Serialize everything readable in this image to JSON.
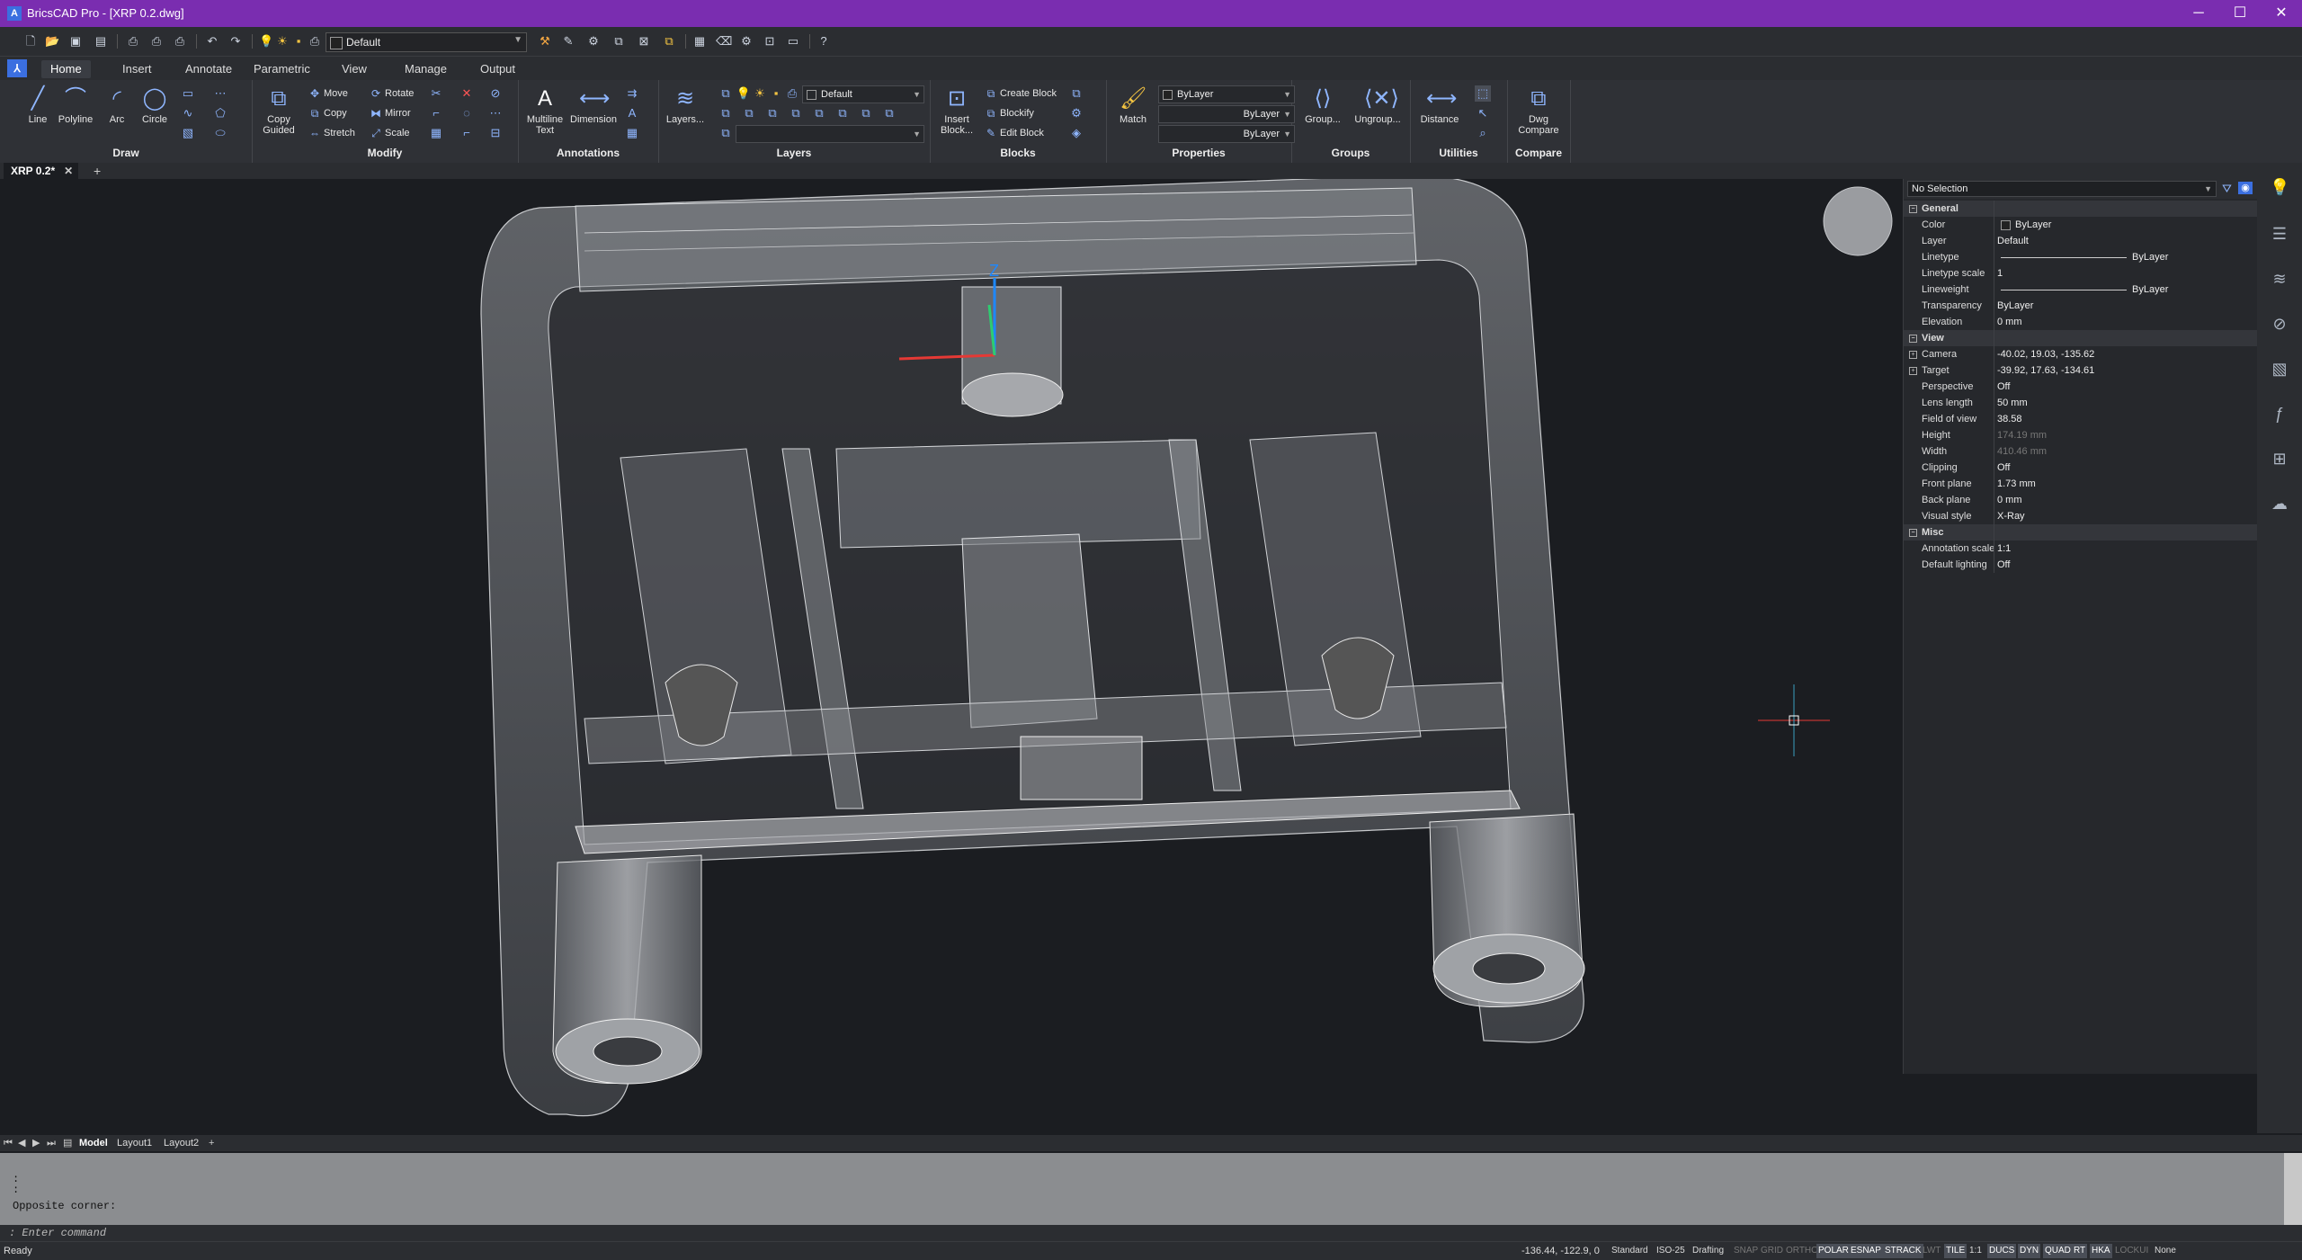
{
  "window": {
    "title": "BricsCAD Pro - [XRP 0.2.dwg]",
    "app_letter": "A"
  },
  "qat": {
    "layer_combo": "Default"
  },
  "ribbon_tabs": [
    "Home",
    "Insert",
    "Annotate",
    "Parametric",
    "View",
    "Manage",
    "Output"
  ],
  "ribbon": {
    "draw": {
      "title": "Draw",
      "line": "Line",
      "polyline": "Polyline",
      "arc": "Arc",
      "circle": "Circle"
    },
    "modify": {
      "title": "Modify",
      "copy_guided": "Copy Guided",
      "move": "Move",
      "copy": "Copy",
      "stretch": "Stretch",
      "rotate": "Rotate",
      "mirror": "Mirror",
      "scale": "Scale"
    },
    "annotations": {
      "title": "Annotations",
      "mtext": "Multiline Text",
      "dimension": "Dimension"
    },
    "layers": {
      "title": "Layers",
      "layers_btn": "Layers...",
      "current_layer": "Default"
    },
    "blocks": {
      "title": "Blocks",
      "insert": "Insert Block...",
      "create": "Create Block",
      "blockify": "Blockify",
      "edit": "Edit Block"
    },
    "properties": {
      "title": "Properties",
      "match": "Match",
      "color": "ByLayer",
      "linetype": "ByLayer",
      "lineweight": "ByLayer"
    },
    "groups": {
      "title": "Groups",
      "group": "Group...",
      "ungroup": "Ungroup..."
    },
    "utilities": {
      "title": "Utilities",
      "distance": "Distance"
    },
    "compare": {
      "title": "Compare",
      "dwg_compare": "Dwg Compare"
    }
  },
  "doc_tabs": [
    {
      "label": "XRP 0.2*"
    }
  ],
  "viewport": {
    "axis_z": "Z"
  },
  "properties_panel": {
    "selection": "No Selection",
    "categories": [
      {
        "name": "General",
        "rows": [
          {
            "key": "Color",
            "value": "ByLayer"
          },
          {
            "key": "Layer",
            "value": "Default"
          },
          {
            "key": "Linetype",
            "value": "ByLayer"
          },
          {
            "key": "Linetype scale",
            "value": "1"
          },
          {
            "key": "Lineweight",
            "value": "ByLayer"
          },
          {
            "key": "Transparency",
            "value": "ByLayer"
          },
          {
            "key": "Elevation",
            "value": "0 mm"
          }
        ]
      },
      {
        "name": "View",
        "rows": [
          {
            "key": "Camera",
            "value": "-40.02, 19.03, -135.62"
          },
          {
            "key": "Target",
            "value": "-39.92, 17.63, -134.61"
          },
          {
            "key": "Perspective",
            "value": "Off"
          },
          {
            "key": "Lens length",
            "value": "50 mm"
          },
          {
            "key": "Field of view",
            "value": "38.58"
          },
          {
            "key": "Height",
            "value": "174.19 mm"
          },
          {
            "key": "Width",
            "value": "410.46 mm"
          },
          {
            "key": "Clipping",
            "value": "Off"
          },
          {
            "key": "Front plane",
            "value": "1.73 mm"
          },
          {
            "key": "Back plane",
            "value": "0 mm"
          },
          {
            "key": "Visual style",
            "value": "X-Ray"
          }
        ]
      },
      {
        "name": "Misc",
        "rows": [
          {
            "key": "Annotation scale",
            "value": "1:1"
          },
          {
            "key": "Default lighting",
            "value": "Off"
          }
        ]
      }
    ]
  },
  "layout_tabs": [
    "Model",
    "Layout1",
    "Layout2"
  ],
  "command": {
    "history": [
      ":",
      ":",
      "Opposite corner:"
    ],
    "prompt": ": Enter command"
  },
  "status": {
    "left": "Ready",
    "coords": "-136.44, -122.9, 0",
    "items": [
      "Standard",
      "ISO-25",
      "Drafting",
      "SNAP",
      "GRID",
      "ORTHO",
      "POLAR",
      "ESNAP",
      "STRACK",
      "LWT",
      "TILE",
      "1:1",
      "DUCS",
      "DYN",
      "QUAD",
      "RT",
      "HKA",
      "LOCKUI",
      "None"
    ],
    "active": [
      "POLAR",
      "ESNAP",
      "STRACK",
      "TILE",
      "DUCS",
      "DYN",
      "QUAD",
      "RT",
      "HKA"
    ]
  }
}
